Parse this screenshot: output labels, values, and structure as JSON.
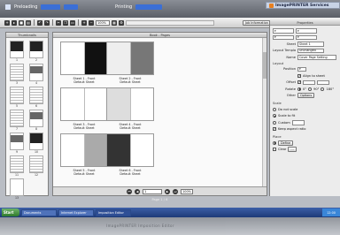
{
  "top_strip": {
    "left_items": [
      "Preloading",
      "Printing"
    ],
    "app_title": "ImagePRINTER Services",
    "accent_color": "#3b6fd6"
  },
  "toolbar": {
    "icons": [
      "new-icon",
      "open-icon",
      "save-icon",
      "print-icon",
      "undo-icon",
      "redo-icon",
      "cut-icon",
      "copy-icon",
      "paste-icon",
      "zoom-in-icon",
      "zoom-out-icon",
      "grid-icon",
      "settings-icon"
    ],
    "zoom_value": "100%",
    "right_button": "Job Information"
  },
  "thumbnail_panel": {
    "title": "Thumbnails",
    "pages": [
      {
        "num": "1",
        "kind": "dark"
      },
      {
        "num": "2",
        "kind": "dark"
      },
      {
        "num": "3",
        "kind": "text"
      },
      {
        "num": "4",
        "kind": "photo"
      },
      {
        "num": "5",
        "kind": "text"
      },
      {
        "num": "6",
        "kind": "text"
      },
      {
        "num": "7",
        "kind": "text"
      },
      {
        "num": "8",
        "kind": "photo"
      },
      {
        "num": "9",
        "kind": "photo"
      },
      {
        "num": "10",
        "kind": "dark"
      },
      {
        "num": "11",
        "kind": "text"
      },
      {
        "num": "12",
        "kind": "text"
      },
      {
        "num": "13",
        "kind": "blank"
      }
    ]
  },
  "main_view": {
    "title": "Book - Pages",
    "spreads": [
      {
        "left": "Sheet 1 - Front",
        "right": "Default Sheet"
      },
      {
        "left": "Sheet 2 - Front",
        "right": "Default Sheet"
      },
      {
        "left": "Sheet 3 - Front",
        "right": "Default Sheet"
      },
      {
        "left": "Sheet 4 - Front",
        "right": "Default Sheet"
      },
      {
        "left": "Sheet 5 - Front",
        "right": "Default Sheet"
      },
      {
        "left": "Sheet 6 - Front",
        "right": "Default Sheet"
      }
    ],
    "page_field": "1",
    "zoom_field": "100%"
  },
  "right_panel": {
    "header": "Properties",
    "rows": [
      {
        "label": "Sheet",
        "value": "Sheet 1"
      },
      {
        "label": "Layout Template",
        "value": "Unchanged"
      },
      {
        "label": "Name",
        "value": "Cover Page Setting"
      }
    ],
    "section_layout": "Layout",
    "position_label": "Position",
    "align_label": "Align to sheet",
    "offset_label": "Offset",
    "rotate_label": "Rotate",
    "rotate_options": [
      "0°",
      "90°",
      "180°"
    ],
    "other_label": "Other",
    "other_button": "Options",
    "scale_label": "Scale",
    "scale_options": [
      "Do not scale",
      "Scale to fit",
      "Custom"
    ],
    "keep_ratio": "Keep aspect ratio",
    "place_label": "Place",
    "place_button": "Define",
    "clear_label": "Clear"
  },
  "status_line": "Page 1 / 6",
  "taskbar": {
    "start_label": "Start",
    "items": [
      "Documents",
      "Internet Explorer",
      "Imposition Editor"
    ],
    "clock": "12:00"
  },
  "reflection_text": "ImagePRINTER Imposition Editor"
}
